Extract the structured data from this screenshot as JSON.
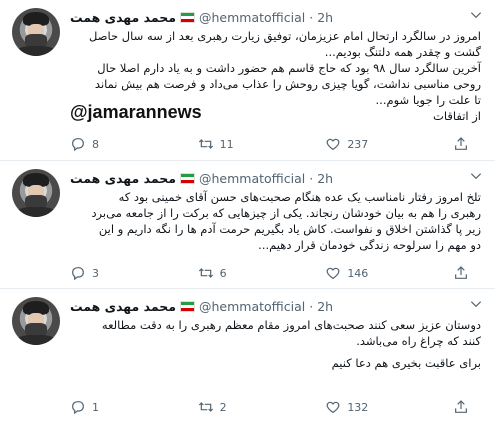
{
  "tweets": [
    {
      "name": "محمد مهدی همت",
      "handle": "@hemmatofficial",
      "dot": "·",
      "time": "2h",
      "lines": [
        "امروز در سالگرد ارتحال امام عزیزمان، توفیق زیارت رهبری بعد از سه سال حاصل",
        "گشت و چقدر همه دلتنگ بودیم...",
        "آخرین سالگرد سال ۹۸ بود که حاج قاسم هم حضور داشت و به یاد دارم اصلا حال",
        "روحی مناسبی نداشت، گویا چیزی روحش را عذاب می‌داد و فرصت هم بیش نماند",
        "تا علت را جویا شوم...",
        "از اتفاقات"
      ],
      "overlay": "@jamarannews",
      "replies": "8",
      "retweets": "11",
      "likes": "237"
    },
    {
      "name": "محمد مهدی همت",
      "handle": "@hemmatofficial",
      "dot": "·",
      "time": "2h",
      "lines": [
        "تلخ امروز رفتار نامناسب یک عده هنگام صحبت‌های حسن آقای خمینی بود که",
        "رهبری را هم به بیان خودشان رنجاند. یکی از چیزهایی که برکت را از جامعه می‌برد",
        "زیر پا گذاشتن اخلاق و نفواست. کاش یاد بگیریم حرمت آدم ها را نگه داریم و این",
        "دو مهم را سرلوحه زندگی خودمان قرار دهیم..."
      ],
      "replies": "3",
      "retweets": "6",
      "likes": "146"
    },
    {
      "name": "محمد مهدی همت",
      "handle": "@hemmatofficial",
      "dot": "·",
      "time": "2h",
      "lines": [
        "دوستان عزیز سعی کنند صحبت‌های امروز مقام معظم رهبری را به دقت مطالعه",
        "کنند که چراغ راه می‌باشد."
      ],
      "lines2": [
        "برای عاقبت بخیری هم دعا کنیم"
      ],
      "replies": "1",
      "retweets": "2",
      "likes": "132"
    }
  ],
  "icons": {
    "reply": "reply-icon",
    "retweet": "retweet-icon",
    "like": "heart-icon",
    "share": "share-icon",
    "more": "chevron-down-icon"
  },
  "colors": {
    "text": "#0f1419",
    "muted": "#536471",
    "divider": "#e6ecf0"
  }
}
